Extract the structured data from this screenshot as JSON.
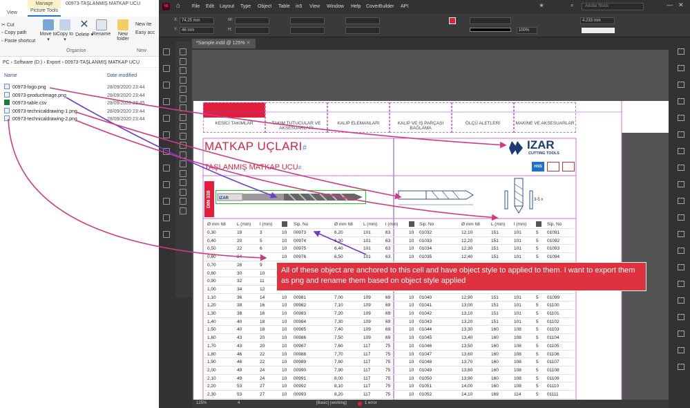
{
  "explorer": {
    "manage_tab": "Manage",
    "title": "00973-TAŞLANMIŞ MATKAP UCU",
    "view_tab": "View",
    "picture_tools_tab": "Picture Tools",
    "ribbon": {
      "cut": "Cut",
      "copy_path": "Copy path",
      "paste_shortcut": "Paste shortcut",
      "move_to": "Move to ▾",
      "copy_to": "Copy to ▾",
      "delete": "Delete ▾",
      "rename": "Rename",
      "new_folder": "New folder",
      "new_item": "New ite",
      "easy_access": "Easy acc",
      "organise": "Organise",
      "new": "New"
    },
    "address": "PC  ›  Software (D:)  ›  Export  ›  00973-TAŞLANMIŞ MATKAP UCU",
    "col_name": "Name",
    "col_date": "Date modified",
    "files": [
      {
        "name": "00973-logo.png",
        "date": "28/09/2020 23:44",
        "type": "png"
      },
      {
        "name": "00973-productimage.png",
        "date": "28/09/2020 23:44",
        "type": "png"
      },
      {
        "name": "00973-table.csv",
        "date": "28/09/2020 23:45",
        "type": "csv"
      },
      {
        "name": "00973-technicaldrawing-1.png",
        "date": "28/09/2020 23:44",
        "type": "png"
      },
      {
        "name": "00973-technicaldrawing-2.png",
        "date": "28/09/2020 23:44",
        "type": "png"
      }
    ]
  },
  "indesign": {
    "menus": [
      "File",
      "Edit",
      "Layout",
      "Type",
      "Object",
      "Table",
      "in5",
      "View",
      "Window",
      "Help",
      "CoverBuilder",
      "API"
    ],
    "search_placeholder": "Adobe Stock",
    "x_value": "74,25 mm",
    "y_value": "46 mm",
    "stroke_value": "4.233 mm",
    "zoom_field": "100%",
    "doc_tab": "*Sample.indd @ 125%",
    "status": {
      "zoom": "125%",
      "page": "4",
      "style": "[Basic] (working)",
      "errors": "1 error"
    }
  },
  "document": {
    "nav_tabs": [
      "KESİCİ TAKIMLAR",
      "TAKIM TUTUCULAR VE AKSESUARLARI",
      "KALIP ELEMANLARI",
      "KALIP VE İŞ PARÇASI BAĞLAMA",
      "ÖLÇÜ ALETLERİ",
      "MAKİNE VE AKSESUARLAR"
    ],
    "title": "MATKAP UÇLARI",
    "subtitle": "TAŞLANMIŞ MATKAP UCU",
    "din_label": "DIN 338",
    "logo_text": "IZAR",
    "logo_sub": "CUTTING TOOLS",
    "hss_badge": "HSS",
    "headers": [
      "Ø mm h8",
      "L (mm)",
      "l (mm)",
      "",
      "Sip. No"
    ],
    "callout": "All of these object are anchored to this cell and have object style to applied to them. I want to export them as png and rename them based on object style applied",
    "col1": [
      [
        "0,30",
        "19",
        "3",
        "10",
        "00973"
      ],
      [
        "0,40",
        "20",
        "5",
        "10",
        "00974"
      ],
      [
        "0,50",
        "22",
        "6",
        "10",
        "00975"
      ],
      [
        "0,60",
        "24",
        "7",
        "10",
        "00976"
      ],
      [
        "0,70",
        "28",
        "9",
        "",
        ""
      ],
      [
        "0,80",
        "30",
        "10",
        "",
        ""
      ],
      [
        "0,90",
        "32",
        "11",
        "",
        ""
      ],
      [
        "1,00",
        "34",
        "12",
        "",
        ""
      ],
      [
        "1,10",
        "36",
        "14",
        "10",
        "00981"
      ],
      [
        "1,20",
        "38",
        "16",
        "10",
        "00982"
      ],
      [
        "1,30",
        "38",
        "16",
        "10",
        "00983"
      ],
      [
        "1,40",
        "40",
        "18",
        "10",
        "00984"
      ],
      [
        "1,50",
        "40",
        "18",
        "10",
        "00985"
      ],
      [
        "1,60",
        "43",
        "20",
        "10",
        "00986"
      ],
      [
        "1,70",
        "43",
        "20",
        "10",
        "00987"
      ],
      [
        "1,80",
        "46",
        "22",
        "10",
        "00988"
      ],
      [
        "1,90",
        "46",
        "22",
        "10",
        "00989"
      ],
      [
        "2,00",
        "49",
        "24",
        "10",
        "00990"
      ],
      [
        "2,10",
        "49",
        "24",
        "10",
        "00991"
      ],
      [
        "2,20",
        "53",
        "27",
        "10",
        "00992"
      ],
      [
        "2,30",
        "53",
        "27",
        "10",
        "00993"
      ],
      [
        "2,40",
        "57",
        "30",
        "10",
        "00994"
      ]
    ],
    "col2": [
      [
        "6,20",
        "101",
        "63",
        "10",
        "01032"
      ],
      [
        "6,30",
        "101",
        "63",
        "10",
        "01033"
      ],
      [
        "6,40",
        "101",
        "63",
        "10",
        "01034"
      ],
      [
        "6,50",
        "101",
        "63",
        "10",
        "01035"
      ],
      [
        "",
        "",
        "",
        "",
        ""
      ],
      [
        "",
        "",
        "",
        "",
        ""
      ],
      [
        "",
        "",
        "",
        "",
        ""
      ],
      [
        "",
        "",
        "",
        "",
        ""
      ],
      [
        "7,00",
        "109",
        "69",
        "10",
        "01040"
      ],
      [
        "7,10",
        "109",
        "69",
        "10",
        "01041"
      ],
      [
        "7,20",
        "109",
        "69",
        "10",
        "01042"
      ],
      [
        "7,30",
        "109",
        "69",
        "10",
        "01043"
      ],
      [
        "7,40",
        "109",
        "69",
        "10",
        "01044"
      ],
      [
        "7,50",
        "109",
        "69",
        "10",
        "01045"
      ],
      [
        "7,60",
        "117",
        "75",
        "10",
        "01046"
      ],
      [
        "7,70",
        "117",
        "75",
        "10",
        "01047"
      ],
      [
        "7,80",
        "117",
        "75",
        "10",
        "01048"
      ],
      [
        "7,90",
        "117",
        "75",
        "10",
        "01049"
      ],
      [
        "8,00",
        "117",
        "75",
        "10",
        "01050"
      ],
      [
        "8,10",
        "117",
        "75",
        "10",
        "01051"
      ],
      [
        "8,20",
        "117",
        "75",
        "10",
        "01052"
      ],
      [
        "8,30",
        "117",
        "75",
        "10",
        "01053"
      ]
    ],
    "col3": [
      [
        "12,10",
        "151",
        "101",
        "5",
        "01091"
      ],
      [
        "12,20",
        "151",
        "101",
        "5",
        "01092"
      ],
      [
        "12,30",
        "151",
        "101",
        "5",
        "01093"
      ],
      [
        "12,40",
        "151",
        "101",
        "5",
        "01094"
      ],
      [
        "",
        "",
        "",
        "",
        ""
      ],
      [
        "",
        "",
        "",
        "",
        ""
      ],
      [
        "",
        "",
        "",
        "",
        ""
      ],
      [
        "",
        "",
        "",
        "",
        ""
      ],
      [
        "12,90",
        "151",
        "101",
        "5",
        "01099"
      ],
      [
        "13,00",
        "151",
        "101",
        "5",
        "01100"
      ],
      [
        "13,10",
        "151",
        "101",
        "5",
        "01101"
      ],
      [
        "13,20",
        "151",
        "101",
        "5",
        "01102"
      ],
      [
        "13,30",
        "160",
        "108",
        "5",
        "01103"
      ],
      [
        "13,40",
        "160",
        "108",
        "5",
        "01104"
      ],
      [
        "13,50",
        "160",
        "108",
        "5",
        "01105"
      ],
      [
        "13,60",
        "160",
        "108",
        "5",
        "01106"
      ],
      [
        "13,70",
        "160",
        "108",
        "5",
        "01107"
      ],
      [
        "13,80",
        "160",
        "108",
        "5",
        "01108"
      ],
      [
        "13,90",
        "160",
        "108",
        "5",
        "01109"
      ],
      [
        "14,00",
        "160",
        "108",
        "5",
        "01110"
      ],
      [
        "14,10",
        "169",
        "114",
        "5",
        "01111"
      ],
      [
        "14,20",
        "169",
        "114",
        "5",
        "01112"
      ]
    ]
  },
  "colors": {
    "accent": "#e21f3a",
    "indesign_dark": "#323232",
    "annotation_arrow": "#d03a80"
  }
}
